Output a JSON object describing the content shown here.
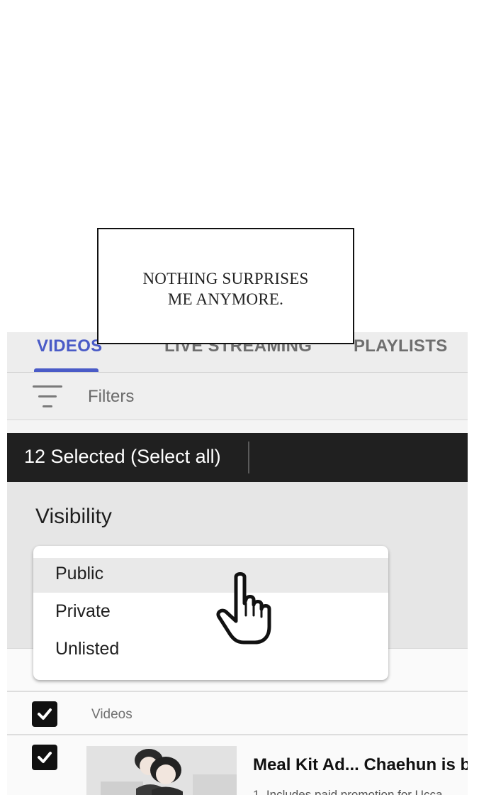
{
  "comic": {
    "caption": "NOTHING SURPRISES\nME ANYMORE."
  },
  "tabs": {
    "videos": "VIDEOS",
    "live_streaming": "LIVE STREAMING",
    "playlists": "PLAYLISTS",
    "active": "VIDEOS"
  },
  "filters": {
    "label": "Filters",
    "icon": "filter-icon"
  },
  "selection_bar": {
    "text": "12 Selected (Select all)"
  },
  "visibility_panel": {
    "title": "Visibility"
  },
  "dropdown": {
    "options": [
      "Public",
      "Private",
      "Unlisted"
    ],
    "highlighted": "Public"
  },
  "video_list": {
    "header_label": "Videos",
    "items": [
      {
        "title": "Meal Kit Ad... Chaehun is b",
        "description": "1. Includes paid promotion for Ucca",
        "checked": true
      }
    ],
    "select_all_checked": true
  },
  "colors": {
    "accent": "#4a5bc7",
    "select_bar": "#202020",
    "panel_bg": "#e6e6e6",
    "highlight": "#e9e9e9"
  },
  "icons": [
    "filter-icon",
    "checkbox-checked-icon",
    "hand-pointer-icon"
  ]
}
